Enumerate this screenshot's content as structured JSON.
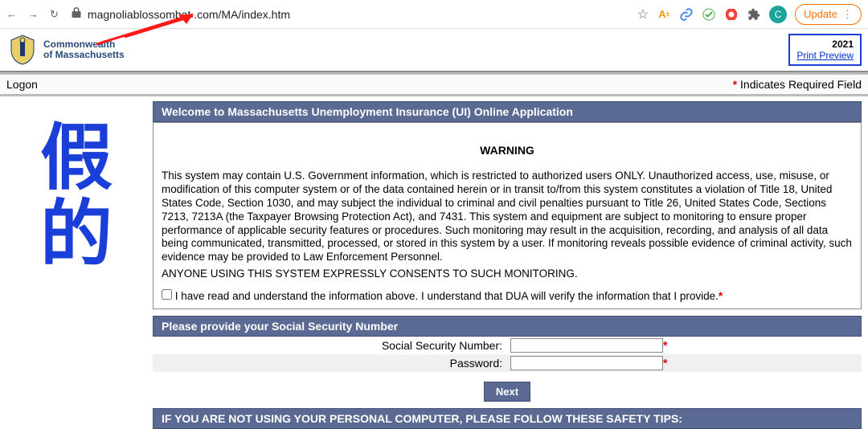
{
  "browser": {
    "url": "magnoliablossombat     .com/MA/index.htm",
    "update_label": "Update",
    "avatar_letter": "C"
  },
  "header": {
    "brand_line1": "Commonwealth",
    "brand_line2": "of Massachusetts",
    "year": "2021",
    "print_preview": "Print Preview"
  },
  "logon": {
    "label": "Logon",
    "required_note": "Indicates Required Field"
  },
  "overlay": {
    "char1": "假",
    "char2": "的"
  },
  "sections": {
    "welcome_title": "Welcome to Massachusetts Unemployment Insurance (UI) Online Application",
    "warning_label": "WARNING",
    "warning_body": "This system may contain U.S. Government information, which is restricted to authorized users ONLY. Unauthorized access, use, misuse, or modification of this computer system or of the data contained herein or in transit to/from this system constitutes a violation of Title 18, United States Code, Section 1030, and may subject the individual to criminal and civil penalties pursuant to Title 26, United States Code, Sections 7213, 7213A (the Taxpayer Browsing Protection Act), and 7431. This system and equipment are subject to monitoring to ensure proper performance of applicable security features or procedures. Such monitoring may result in the acquisition, recording, and analysis of all data being communicated, transmitted, processed, or stored in this system by a user. If monitoring reveals possible evidence of criminal activity, such evidence may be provided to Law Enforcement Personnel.",
    "consent_line": "ANYONE USING THIS SYSTEM EXPRESSLY CONSENTS TO SUCH MONITORING.",
    "consent_checkbox": "I have read and understand the information above. I understand that DUA will verify the information that I provide.",
    "ssn_title": "Please provide your Social Security Number",
    "ssn_label": "Social Security Number:",
    "password_label": "Password:",
    "next_button": "Next",
    "safety_title": "IF YOU ARE NOT USING YOUR PERSONAL COMPUTER, PLEASE FOLLOW THESE SAFETY TIPS:"
  }
}
